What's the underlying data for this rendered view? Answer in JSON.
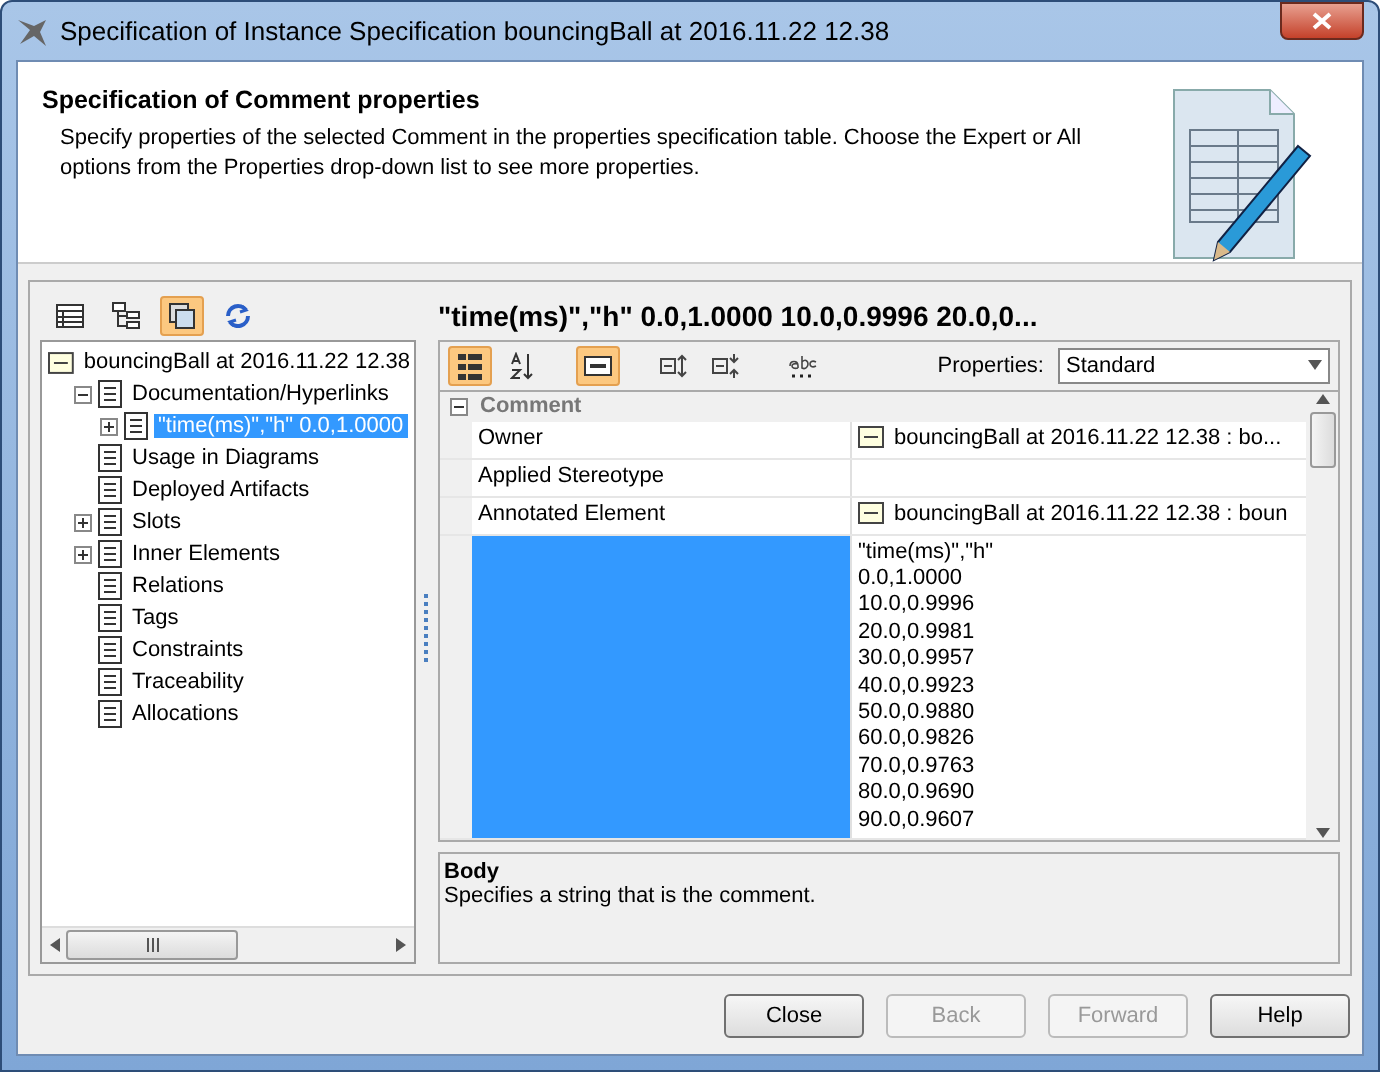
{
  "window": {
    "title": "Specification of Instance Specification bouncingBall at 2016.11.22 12.38"
  },
  "header": {
    "title": "Specification of Comment properties",
    "description": "Specify properties of the selected Comment in the properties specification table. Choose the Expert or All options from the Properties drop-down list to see more properties."
  },
  "tree_toolbar": [
    {
      "kind": "table",
      "selected": false
    },
    {
      "kind": "tree",
      "selected": false
    },
    {
      "kind": "windows",
      "selected": true
    },
    {
      "kind": "refresh",
      "selected": false
    }
  ],
  "tree": {
    "label": "bouncingBall at 2016.11.22 12.38",
    "selected": false,
    "children": [
      {
        "label": "Documentation/Hyperlinks",
        "expandable": true,
        "expanded": true,
        "selected": false,
        "children": [
          {
            "label": "\"time(ms)\",\"h\" 0.0,1.0000",
            "expandable": true,
            "expanded": false,
            "selected": true
          }
        ]
      },
      {
        "label": "Usage in Diagrams",
        "expandable": false,
        "selected": false
      },
      {
        "label": "Deployed Artifacts",
        "expandable": false,
        "selected": false
      },
      {
        "label": "Slots",
        "expandable": true,
        "expanded": false,
        "selected": false
      },
      {
        "label": "Inner Elements",
        "expandable": true,
        "expanded": false,
        "selected": false
      },
      {
        "label": "Relations",
        "expandable": false,
        "selected": false
      },
      {
        "label": "Tags",
        "expandable": false,
        "selected": false
      },
      {
        "label": "Constraints",
        "expandable": false,
        "selected": false
      },
      {
        "label": "Traceability",
        "expandable": false,
        "selected": false
      },
      {
        "label": "Allocations",
        "expandable": false,
        "selected": false
      }
    ]
  },
  "element_title": "\"time(ms)\",\"h\" 0.0,1.0000 10.0,0.9996 20.0,0...",
  "properties_toolbar": [
    {
      "kind": "categorized",
      "selected": true
    },
    {
      "kind": "sort",
      "selected": false
    },
    {
      "kind": "panel",
      "selected": true
    },
    {
      "kind": "expand",
      "selected": false
    },
    {
      "kind": "collapse",
      "selected": false
    },
    {
      "kind": "abc",
      "selected": false
    }
  ],
  "properties_filter": {
    "label": "Properties:",
    "value": "Standard"
  },
  "property_group": {
    "label": "Comment",
    "expanded": true
  },
  "properties": [
    {
      "name": "Owner",
      "kind": "element",
      "selected": false,
      "value": [
        "bouncingBall at 2016.11.22 12.38 : bo..."
      ]
    },
    {
      "name": "Applied Stereotype",
      "kind": "text",
      "selected": false
    },
    {
      "name": "Annotated Element",
      "kind": "element",
      "selected": false,
      "value": [
        "bouncingBall at 2016.11.22 12.38 : boun"
      ]
    },
    {
      "kind": "text",
      "selected": true,
      "value": [
        "\"time(ms)\",\"h\"",
        "0.0,1.0000",
        "10.0,0.9996",
        "20.0,0.9981",
        "30.0,0.9957",
        "40.0,0.9923",
        "50.0,0.9880",
        "60.0,0.9826",
        "70.0,0.9763",
        "80.0,0.9690",
        "90.0,0.9607"
      ]
    }
  ],
  "description": {
    "title": "Body",
    "text": "Specifies a string that is the comment."
  },
  "buttons": [
    {
      "label": "Close",
      "disabled": false
    },
    {
      "label": "Back",
      "disabled": true
    },
    {
      "label": "Forward",
      "disabled": true
    },
    {
      "label": "Help",
      "disabled": false
    }
  ]
}
